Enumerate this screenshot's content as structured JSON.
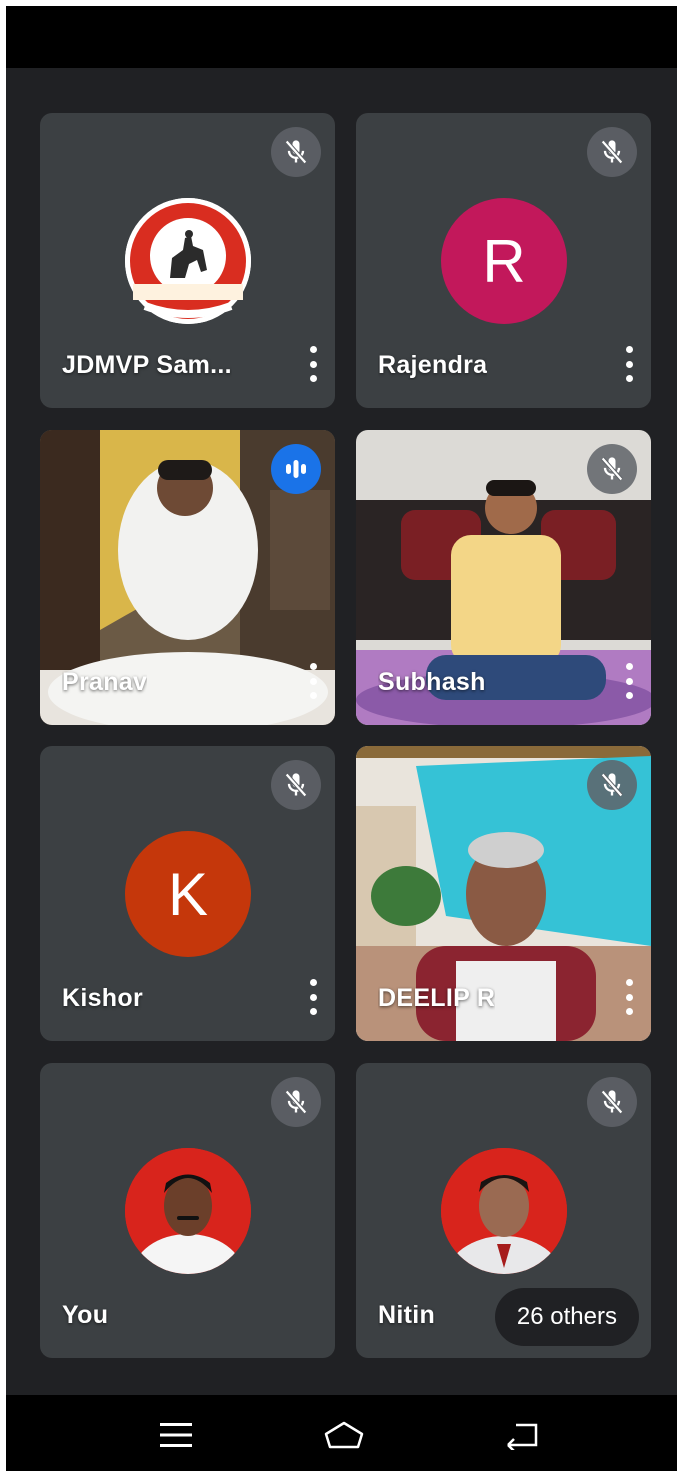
{
  "participants": [
    {
      "name": "JDMVP Sam...",
      "muted": true
    },
    {
      "name": "Rajendra",
      "initial": "R",
      "avatar_color": "#c2185b",
      "muted": true
    },
    {
      "name": "Pranav",
      "speaking": true
    },
    {
      "name": "Subhash",
      "muted": true
    },
    {
      "name": "Kishor",
      "initial": "K",
      "avatar_color": "#c5370b",
      "muted": true
    },
    {
      "name": "DEELIP R",
      "muted": true
    },
    {
      "name": "You",
      "muted": true
    },
    {
      "name": "Nitin",
      "muted": true
    }
  ],
  "logo": {
    "top_text": "जळगाव जिल्हा मराठा विद्या प्रसारक सह. समाज",
    "ribbon_text": "कला, विज्ञान व वाणिज्य",
    "bottom_text": "महाविद्यालय, जळगाव"
  },
  "others_button": {
    "label": "26 others"
  },
  "icons": {
    "mic_off": "mic-off-icon",
    "speaking": "audio-level-icon",
    "more": "more-vert-icon",
    "nav_menu": "menu-icon",
    "nav_home": "home-icon",
    "nav_back": "back-icon"
  },
  "colors": {
    "background": "#202124",
    "tile": "#3c4043",
    "speaking_badge": "#1a73e8"
  }
}
